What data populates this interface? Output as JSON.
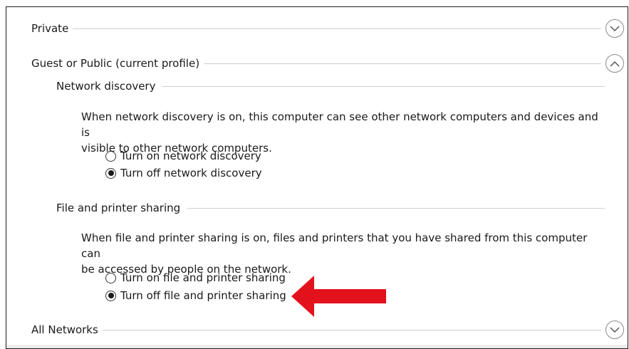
{
  "sections": {
    "private": {
      "label": "Private",
      "expanded": false
    },
    "guest": {
      "label": "Guest or Public (current profile)",
      "expanded": true,
      "network_discovery": {
        "title": "Network discovery",
        "description_line1": "When network discovery is on, this computer can see other network computers and devices and is",
        "description_line2": "visible to other network computers.",
        "options": [
          {
            "label": "Turn on network discovery",
            "selected": false
          },
          {
            "label": "Turn off network discovery",
            "selected": true
          }
        ]
      },
      "file_sharing": {
        "title": "File and printer sharing",
        "description_line1": "When file and printer sharing is on, files and printers that you have shared from this computer can",
        "description_line2": "be accessed by people on the network.",
        "options": [
          {
            "label": "Turn on file and printer sharing",
            "selected": false
          },
          {
            "label": "Turn off file and printer sharing",
            "selected": true
          }
        ]
      }
    },
    "all_networks": {
      "label": "All Networks",
      "expanded": false
    }
  },
  "icons": {
    "expand": "chevron-down-icon",
    "collapse": "chevron-up-icon",
    "annotation": "red-arrow-icon"
  },
  "colors": {
    "annotation_arrow": "#e3111c",
    "divider": "#cfcfcf",
    "frame_border": "#1a1a1a"
  }
}
